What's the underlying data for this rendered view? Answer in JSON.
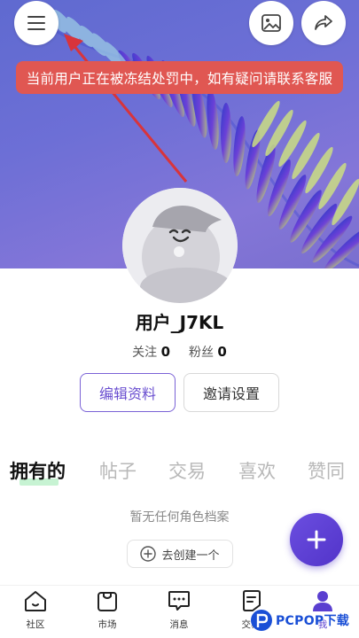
{
  "colors": {
    "accent": "#6a4fd0",
    "toast_bg": "#e05752",
    "banner": "#6d6fd6"
  },
  "header": {
    "menu_icon": "hamburger-icon",
    "image_icon": "image-icon",
    "share_icon": "share-icon"
  },
  "toast": {
    "text": "当前用户正在被冻结处罚中，如有疑问请联系客服"
  },
  "profile": {
    "username": "用户_J7KL",
    "following_label": "关注",
    "following_count": "0",
    "followers_label": "粉丝",
    "followers_count": "0",
    "edit_label": "编辑资料",
    "invite_label": "邀请设置"
  },
  "tabs": [
    {
      "label": "拥有的",
      "active": true
    },
    {
      "label": "帖子"
    },
    {
      "label": "交易"
    },
    {
      "label": "喜欢"
    },
    {
      "label": "赞同"
    }
  ],
  "empty_state": {
    "text": "暂无任何角色档案",
    "create_label": "去创建一个"
  },
  "nav": [
    {
      "label": "社区",
      "icon": "home-icon"
    },
    {
      "label": "市场",
      "icon": "shop-bag-icon"
    },
    {
      "label": "消息",
      "icon": "message-icon"
    },
    {
      "label": "交易",
      "icon": "trade-icon"
    },
    {
      "label": "我",
      "icon": "profile-icon",
      "active": true
    }
  ],
  "watermark": {
    "text": "PCPOP下载"
  }
}
